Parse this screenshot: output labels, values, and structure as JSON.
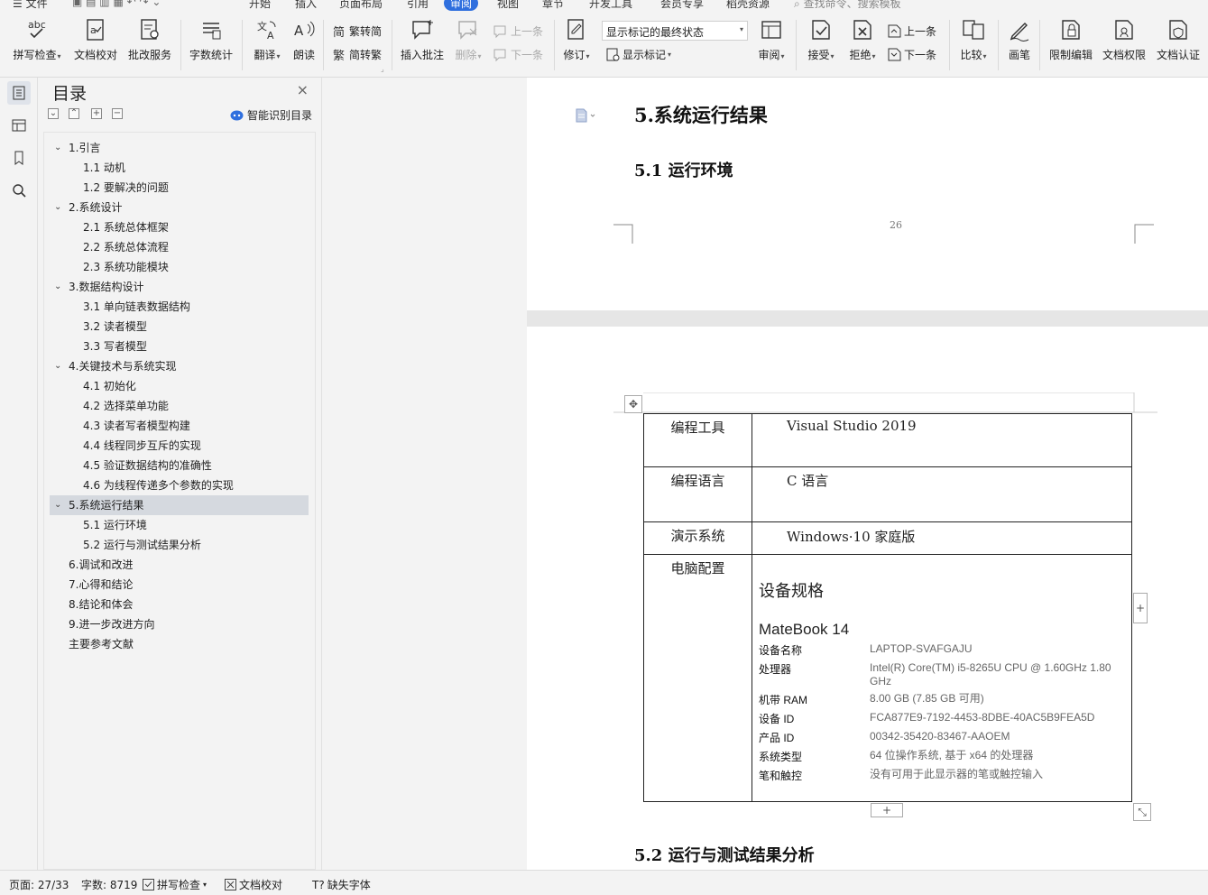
{
  "menubar": {
    "file": "文件",
    "tabs": [
      "开始",
      "插入",
      "页面布局",
      "引用",
      "审阅",
      "视图",
      "章节",
      "开发工具",
      "会员专享",
      "稻壳资源"
    ],
    "active_tab": "审阅",
    "search": "查找命令、搜索模板"
  },
  "ribbon": {
    "spellcheck": "拼写检查",
    "doc_proof": "文档校对",
    "correct_service": "批改服务",
    "word_count": "字数统计",
    "translate": "翻译",
    "read_aloud": "朗读",
    "trad_to_simp": "繁转简",
    "simp_to_trad": "简转繁",
    "insert_comment": "插入批注",
    "delete": "删除",
    "prev_comment": "上一条",
    "next_comment": "下一条",
    "track_changes": "修订",
    "markup_state": "显示标记的最终状态",
    "show_markup": "显示标记",
    "review": "审阅",
    "accept": "接受",
    "reject": "拒绝",
    "prev_change": "上一条",
    "next_change": "下一条",
    "compare": "比较",
    "ink": "画笔",
    "restrict_edit": "限制编辑",
    "doc_permission": "文档权限",
    "doc_certify": "文档认证"
  },
  "toc": {
    "title": "目录",
    "smart": "智能识别目录",
    "items": [
      {
        "label": "1.引言",
        "level": 1,
        "expanded": true
      },
      {
        "label": "1.1 动机",
        "level": 2
      },
      {
        "label": "1.2  要解决的问题",
        "level": 2
      },
      {
        "label": "2.系统设计",
        "level": 1,
        "expanded": true
      },
      {
        "label": "2.1 系统总体框架",
        "level": 2
      },
      {
        "label": "2.2  系统总体流程",
        "level": 2
      },
      {
        "label": "2.3  系统功能模块",
        "level": 2
      },
      {
        "label": "3.数据结构设计",
        "level": 1,
        "expanded": true
      },
      {
        "label": "3.1 单向链表数据结构",
        "level": 2
      },
      {
        "label": "3.2 读者模型",
        "level": 2
      },
      {
        "label": "3.3 写者模型",
        "level": 2
      },
      {
        "label": "4.关键技术与系统实现",
        "level": 1,
        "expanded": true
      },
      {
        "label": "4.1 初始化",
        "level": 2
      },
      {
        "label": "4.2 选择菜单功能",
        "level": 2
      },
      {
        "label": "4.3 读者写者模型构建",
        "level": 2
      },
      {
        "label": "4.4 线程同步互斥的实现",
        "level": 2
      },
      {
        "label": "4.5 验证数据结构的准确性",
        "level": 2
      },
      {
        "label": "4.6 为线程传递多个参数的实现",
        "level": 2
      },
      {
        "label": "5.系统运行结果",
        "level": 1,
        "expanded": true,
        "selected": true
      },
      {
        "label": "5.1 运行环境",
        "level": 2
      },
      {
        "label": "5.2 运行与测试结果分析",
        "level": 2
      },
      {
        "label": "6.调试和改进",
        "level": 1
      },
      {
        "label": "7.心得和结论",
        "level": 1
      },
      {
        "label": "8.结论和体会",
        "level": 1
      },
      {
        "label": "9.进一步改进方向",
        "level": 1
      },
      {
        "label": "主要参考文献",
        "level": 1
      }
    ]
  },
  "document": {
    "heading5": "5.系统运行结果",
    "heading51": "5.1 运行环境",
    "page_number": "26",
    "heading52": "5.2 运行与测试结果分析",
    "table": {
      "rows": [
        {
          "key": "编程工具",
          "value": "Visual Studio 2019"
        },
        {
          "key": "编程语言",
          "value": "C 语言"
        },
        {
          "key": "演示系统",
          "value": "Windows·10  家庭版"
        },
        {
          "key": "电脑配置",
          "value": ""
        }
      ],
      "spec": {
        "title": "设备规格",
        "model": "MateBook 14",
        "rows": [
          {
            "k": "设备名称",
            "v": "LAPTOP-SVAFGAJU"
          },
          {
            "k": "处理器",
            "v": "Intel(R) Core(TM) i5-8265U CPU @ 1.60GHz   1.80 GHz"
          },
          {
            "k": "机带 RAM",
            "v": "8.00 GB (7.85 GB 可用)"
          },
          {
            "k": "设备 ID",
            "v": "FCA877E9-7192-4453-8DBE-40AC5B9FEA5D"
          },
          {
            "k": "产品 ID",
            "v": "00342-35420-83467-AAOEM"
          },
          {
            "k": "系统类型",
            "v": "64 位操作系统, 基于 x64 的处理器"
          },
          {
            "k": "笔和触控",
            "v": "没有可用于此显示器的笔或触控输入"
          }
        ]
      }
    }
  },
  "status": {
    "page": "页面: 27/33",
    "words": "字数: 8719",
    "spellcheck": "拼写检查",
    "doc_proof": "文档校对",
    "missing_font": "缺失字体"
  }
}
